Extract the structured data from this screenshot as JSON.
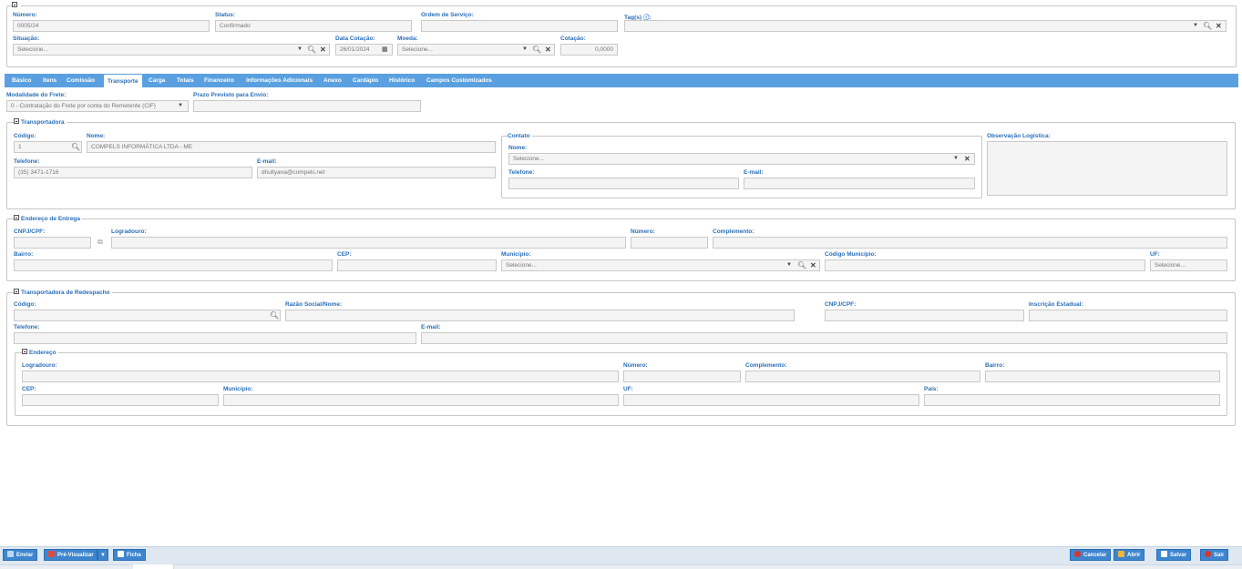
{
  "header": {
    "numero_label": "Número:",
    "numero_value": "0005/24",
    "status_label": "Status:",
    "status_value": "Confirmado",
    "ordem_label": "Ordem de Serviço:",
    "ordem_value": "",
    "tags_label": "Tag(s) ⓘ:",
    "situacao_label": "Situação:",
    "situacao_placeholder": "Selecione...",
    "data_cotacao_label": "Data Cotação:",
    "data_cotacao_value": "26/01/2024",
    "moeda_label": "Moeda:",
    "moeda_placeholder": "Selecione...",
    "cotacao_label": "Cotação:",
    "cotacao_value": "0,0000"
  },
  "tabs": [
    {
      "label": "Básico"
    },
    {
      "label": "Itens"
    },
    {
      "label": "Comissão"
    },
    {
      "label": "Transporte"
    },
    {
      "label": "Carga"
    },
    {
      "label": "Totais"
    },
    {
      "label": "Financeiro"
    },
    {
      "label": "Informações Adicionais"
    },
    {
      "label": "Anexo"
    },
    {
      "label": "Cardápio"
    },
    {
      "label": "Histórico"
    },
    {
      "label": "Campos Customizados"
    }
  ],
  "frete": {
    "modalidade_label": "Modalidade do Frete:",
    "modalidade_value": "0 - Contratação do Frete por conta do Remetente (CIF)",
    "prazo_label": "Prazo Previsto para Envio:",
    "prazo_value": ""
  },
  "transportadora": {
    "legend": "Transportadora",
    "codigo_label": "Código:",
    "codigo_value": "1",
    "nome_label": "Nome:",
    "nome_value": "COMPELS INFORMÁTICA LTDA - ME",
    "telefone_label": "Telefone:",
    "telefone_value": "(35) 3471-1716",
    "email_label": "E-mail:",
    "email_value": "dhullyana@compels.net",
    "contato_legend": "Contato",
    "contato_nome_label": "Nome:",
    "contato_nome_placeholder": "Selecione...",
    "contato_telefone_label": "Telefone:",
    "contato_email_label": "E-mail:",
    "obs_label": "Observação Logística:"
  },
  "entrega": {
    "legend": "Endereço de Entrega",
    "cnpj_label": "CNPJ/CPF:",
    "logradouro_label": "Logradouro:",
    "numero_label": "Número:",
    "complemento_label": "Complemento:",
    "bairro_label": "Bairro:",
    "cep_label": "CEP:",
    "municipio_label": "Município:",
    "municipio_placeholder": "Selecione...",
    "codigo_municipio_label": "Código Município:",
    "uf_label": "UF:",
    "uf_placeholder": "Selecione..."
  },
  "redespacho": {
    "legend": "Transportadora de Redespacho",
    "codigo_label": "Código:",
    "razao_label": "Razão Social/Nome:",
    "cnpj_label": "CNPJ/CPF:",
    "ie_label": "Inscrição Estadual:",
    "telefone_label": "Telefone:",
    "email_label": "E-mail:",
    "endereco_legend": "Endereço",
    "logradouro_label": "Logradouro:",
    "numero_label": "Número:",
    "complemento_label": "Complemento:",
    "bairro_label": "Bairro:",
    "cep_label": "CEP:",
    "municipio_label": "Município:",
    "uf_label": "UF:",
    "pais_label": "País:"
  },
  "footer": {
    "enviar": "Enviar",
    "pre_visualizar": "Pré-Visualizar",
    "ficha": "Ficha",
    "cancelar": "Cancelar",
    "abrir": "Abrir",
    "salvar": "Salvar",
    "sair": "Sair"
  },
  "colors": {
    "accent": "#5aa0e0",
    "label": "#2a6fb8",
    "cancel_icon": "#d9352a",
    "open_icon": "#f0b43a"
  }
}
